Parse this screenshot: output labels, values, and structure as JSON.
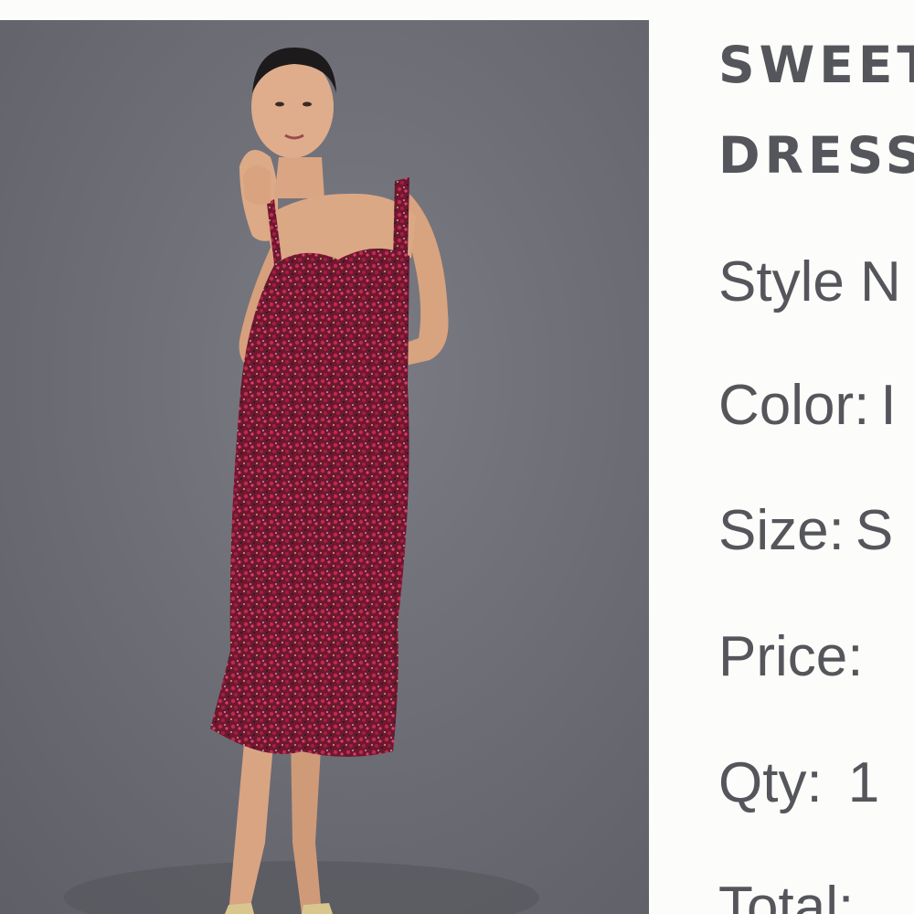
{
  "product": {
    "title_line1": "SWEET",
    "title_line2": "DRESS",
    "image_alt": "Model wearing red floral print midi dress with sweetheart neckline",
    "colors": {
      "background": "#fcfcfa",
      "photo_backdrop": "#6e6e76",
      "text": "#55565b",
      "dress": "#7a1f3a"
    }
  },
  "details": {
    "style_label": "Style N",
    "color_label": "Color:",
    "color_value": "I",
    "size_label": "Size:",
    "size_value": "S",
    "price_label": "Price:",
    "qty_label": "Qty:",
    "qty_value": "1",
    "total_label": "Total:"
  }
}
